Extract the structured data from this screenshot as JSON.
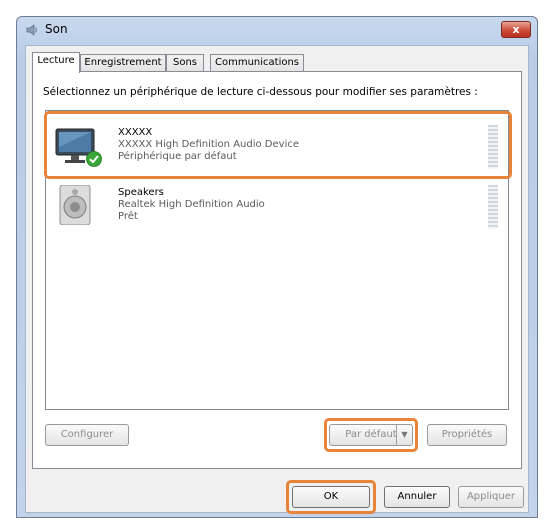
{
  "window": {
    "title": "Son",
    "close_label": "x"
  },
  "tabs": [
    {
      "label": "Lecture"
    },
    {
      "label": "Enregistrement"
    },
    {
      "label": "Sons"
    },
    {
      "label": "Communications"
    }
  ],
  "panel": {
    "instruction": "Sélectionnez un périphérique de lecture ci-dessous pour modifier ses paramètres :"
  },
  "devices": [
    {
      "name": "XXXXX",
      "description": "XXXXX High Definition Audio Device",
      "status": "Périphérique par défaut",
      "icon": "monitor-icon",
      "default": true,
      "selected": true
    },
    {
      "name": "Speakers",
      "description": "Realtek High Definition Audio",
      "status": "Prêt",
      "icon": "speaker-icon",
      "default": false,
      "selected": false
    }
  ],
  "buttons": {
    "configure": "Configurer",
    "set_default": "Par défaut",
    "properties": "Propriétés",
    "ok": "OK",
    "cancel": "Annuler",
    "apply": "Appliquer"
  },
  "colors": {
    "highlight": "#e8843a",
    "default_check": "#3aa63a",
    "close_button": "#cd4c3a"
  }
}
